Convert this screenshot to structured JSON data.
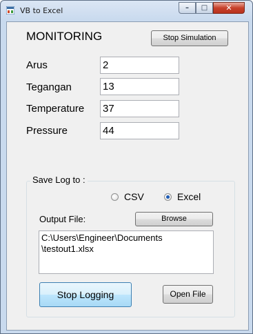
{
  "window": {
    "title": "VB to Excel",
    "minimize_glyph": "–",
    "maximize_glyph": "□",
    "close_glyph": "✕"
  },
  "monitor": {
    "heading": "MONITORING",
    "stop_simulation_label": "Stop Simulation",
    "fields": [
      {
        "label": "Arus",
        "value": "2"
      },
      {
        "label": "Tegangan",
        "value": "13"
      },
      {
        "label": "Temperature",
        "value": "37"
      },
      {
        "label": "Pressure",
        "value": "44"
      }
    ]
  },
  "log": {
    "group_title": "Save Log to :",
    "options": [
      {
        "label": "CSV",
        "selected": false
      },
      {
        "label": "Excel",
        "selected": true
      }
    ],
    "output_label": "Output File:",
    "browse_label": "Browse",
    "output_path": "C:\\Users\\Engineer\\Documents\n\\testout1.xlsx",
    "stop_logging_label": "Stop Logging",
    "open_file_label": "Open File"
  },
  "colors": {
    "accent": "#1d5bb5",
    "close_button": "#c7412b"
  }
}
